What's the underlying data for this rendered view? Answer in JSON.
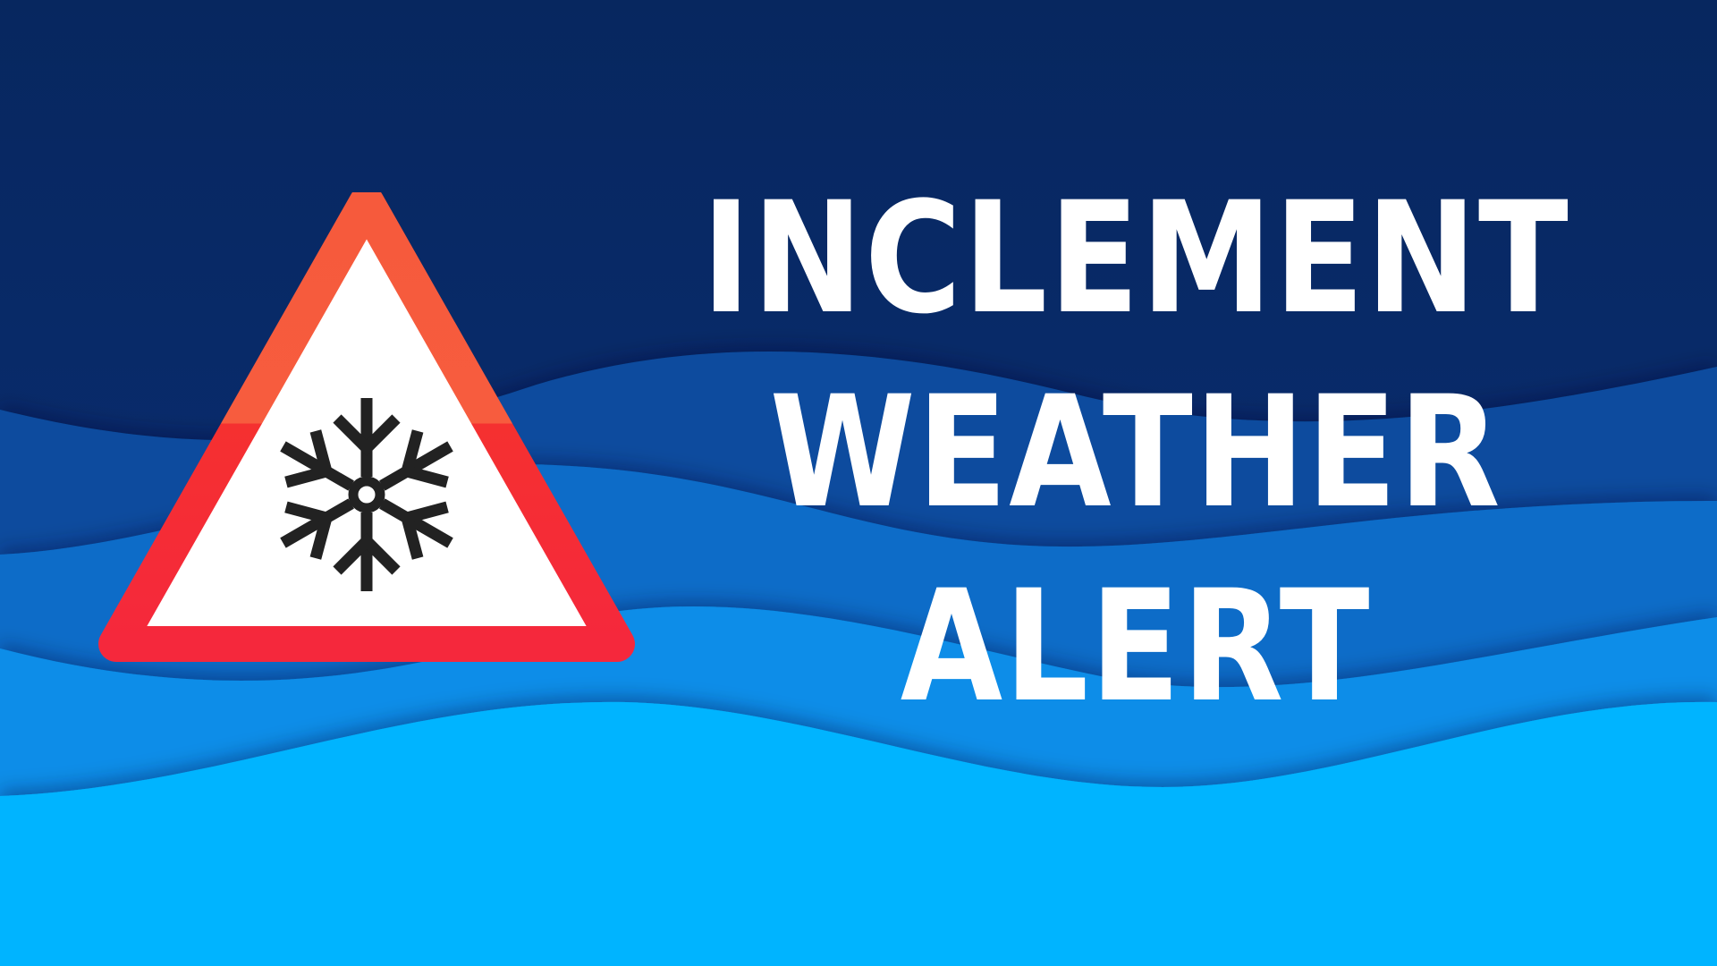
{
  "headline": {
    "line1": "INCLEMENT",
    "line2": "WEATHER",
    "line3": "ALERT"
  },
  "icons": {
    "warning": "warning-triangle-icon",
    "snow": "snowflake-icon"
  },
  "colors": {
    "sky_dark": "#0a2a6e",
    "wave_1": "#0a4c9e",
    "wave_2": "#0a6cc8",
    "wave_3": "#0a8de8",
    "wave_4": "#00b4ff",
    "sign_border_top": "#f65a3c",
    "sign_border_bottom": "#f5283c",
    "sign_fill": "#ffffff",
    "snowflake": "#222222",
    "text": "#ffffff"
  }
}
